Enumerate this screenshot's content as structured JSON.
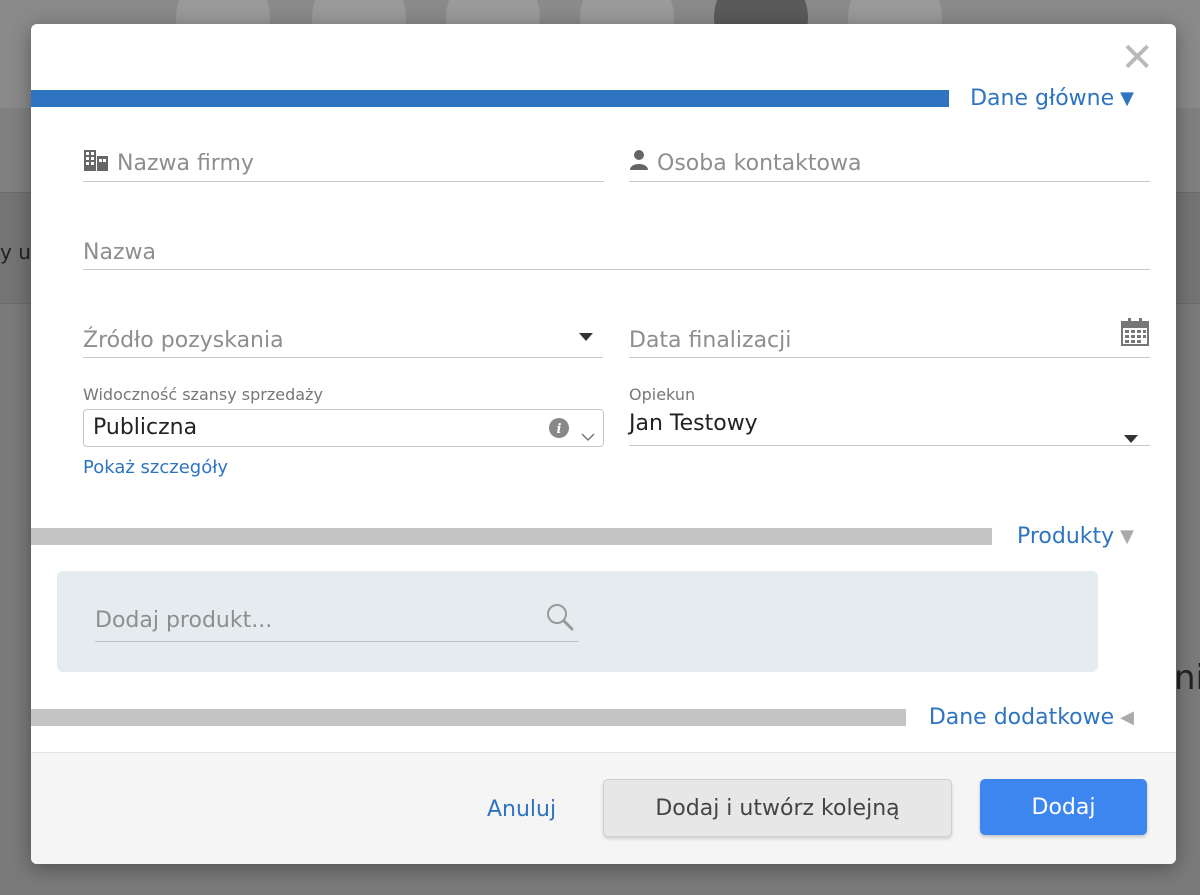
{
  "background": {
    "left_fragment": "y u",
    "right_fragment": "ni"
  },
  "modal": {
    "close_icon": "close-icon",
    "sections": {
      "main": {
        "label": "Dane główne",
        "state": "expanded",
        "color": "#2f74c1"
      },
      "products": {
        "label": "Produkty",
        "state": "expanded",
        "color": "#c4c4c4"
      },
      "additional": {
        "label": "Dane dodatkowe",
        "state": "collapsed",
        "color": "#c4c4c4"
      }
    },
    "fields": {
      "company_name": {
        "placeholder": "Nazwa firmy",
        "icon": "building-icon"
      },
      "contact_person": {
        "placeholder": "Osoba kontaktowa",
        "icon": "user-icon"
      },
      "name": {
        "placeholder": "Nazwa"
      },
      "source": {
        "placeholder": "Źródło pozyskania",
        "icon": "caret-down-icon"
      },
      "finalization_date": {
        "placeholder": "Data finalizacji",
        "icon": "calendar-icon"
      },
      "visibility": {
        "label": "Widoczność szansy sprzedaży",
        "value": "Publiczna",
        "icons": [
          "info-icon",
          "chevron-down-icon"
        ]
      },
      "owner": {
        "label": "Opiekun",
        "value": "Jan Testowy",
        "icon": "caret-down-icon"
      }
    },
    "show_details_link": "Pokaż szczegóły",
    "products": {
      "search_placeholder": "Dodaj produkt...",
      "search_icon": "search-icon"
    },
    "footer": {
      "cancel_label": "Anuluj",
      "add_and_new_label": "Dodaj i utwórz kolejną",
      "add_label": "Dodaj"
    }
  }
}
